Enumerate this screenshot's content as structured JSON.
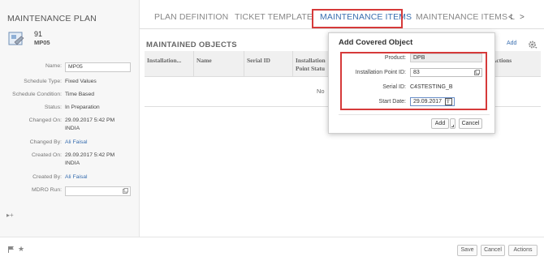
{
  "left_panel": {
    "title": "MAINTENANCE PLAN",
    "plan_id": "91",
    "plan_code": "MP05",
    "fields": {
      "name_label": "Name:",
      "name_value": "MP05",
      "schedule_type_label": "Schedule Type:",
      "schedule_type_value": "Fixed Values",
      "schedule_condition_label": "Schedule Condition:",
      "schedule_condition_value": "Time Based",
      "status_label": "Status:",
      "status_value": "In Preparation",
      "changed_on_label": "Changed On:",
      "changed_on_value": "29.09.2017 5:42 PM",
      "changed_on_tz": "INDIA",
      "changed_by_label": "Changed By:",
      "changed_by_value": "Ali Faisal",
      "created_on_label": "Created On:",
      "created_on_value": "29.09.2017 5:42 PM",
      "created_on_tz": "INDIA",
      "created_by_label": "Created By:",
      "created_by_value": "Ali Faisal",
      "mdro_run_label": "MDRO Run:",
      "mdro_run_value": ""
    },
    "tag_text": "▸+"
  },
  "tabs": [
    {
      "label": "PLAN DEFINITION"
    },
    {
      "label": "TICKET TEMPLATE"
    },
    {
      "label": "MAINTENANCE ITEMS"
    },
    {
      "label": "MAINTENANCE ITEMS L"
    }
  ],
  "tab_nav": {
    "prev": "<",
    "next": ">"
  },
  "section": {
    "title": "MAINTAINED OBJECTS",
    "add_label": "Add",
    "columns": [
      "Installation...",
      "Name",
      "Serial ID",
      "Installation",
      "Point Statu",
      "Actions"
    ],
    "no_data": "No"
  },
  "dialog": {
    "title": "Add Covered Object",
    "product_label": "Product:",
    "product_value": "DPB",
    "installation_point_label": "Installation Point ID:",
    "installation_point_value": "83",
    "serial_label": "Serial ID:",
    "serial_value": "C4STESTING_B",
    "start_date_label": "Start Date:",
    "start_date_value": "29.09.2017",
    "add_button": "Add",
    "cancel_button": "Cancel"
  },
  "footer": {
    "save": "Save",
    "cancel": "Cancel",
    "actions": "Actions"
  },
  "colors": {
    "accent": "#3a6fb0",
    "highlight": "#d63a3a"
  }
}
